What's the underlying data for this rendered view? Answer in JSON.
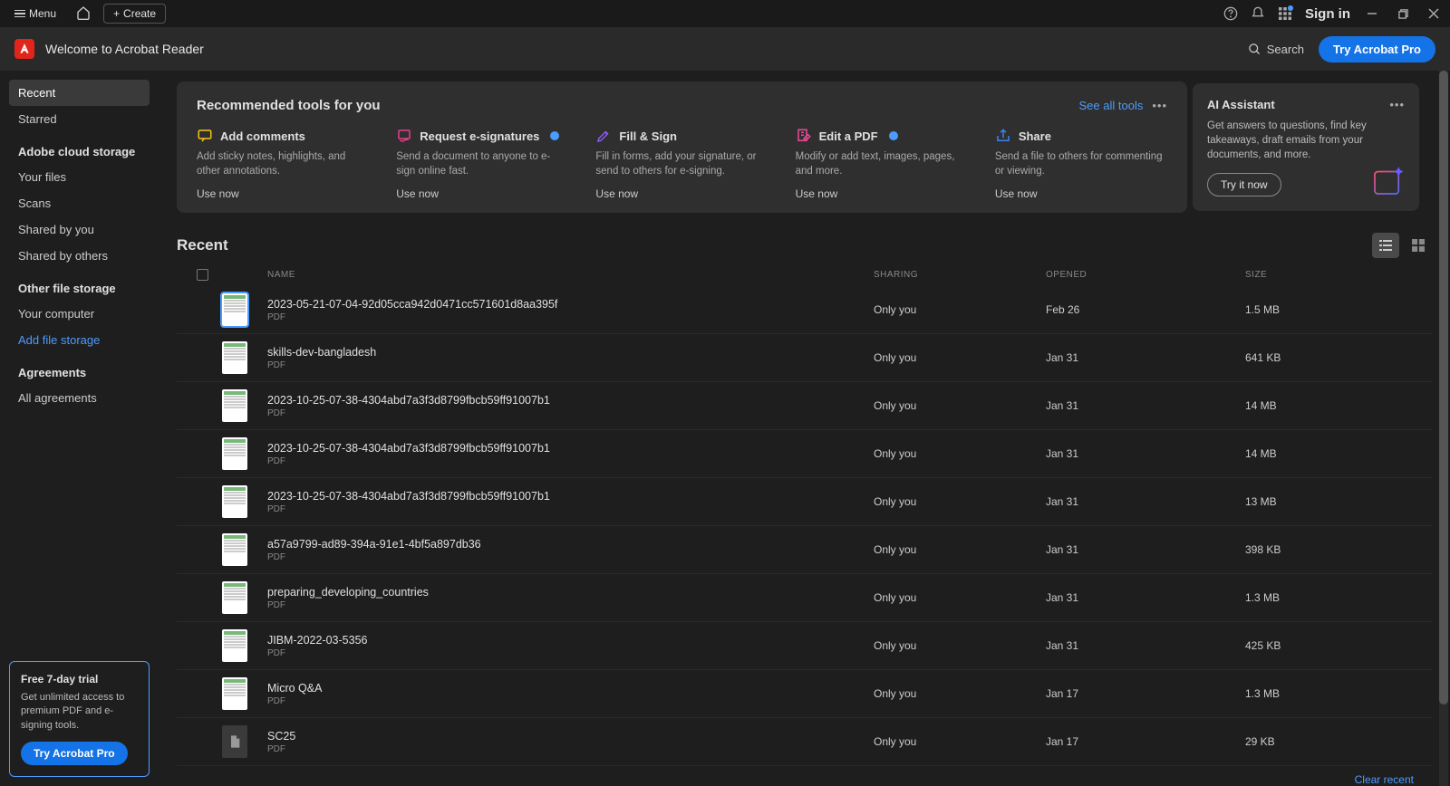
{
  "titlebar": {
    "menu": "Menu",
    "create": "Create",
    "signIn": "Sign in"
  },
  "appbar": {
    "title": "Welcome to Acrobat Reader",
    "search": "Search",
    "tryPro": "Try Acrobat Pro"
  },
  "sidebar": {
    "items": [
      "Recent",
      "Starred"
    ],
    "headers": {
      "cloud": "Adobe cloud storage",
      "other": "Other file storage",
      "agreements": "Agreements"
    },
    "cloud": [
      "Your files",
      "Scans",
      "Shared by you",
      "Shared by others"
    ],
    "other": [
      "Your computer",
      "Add file storage"
    ],
    "agreements": [
      "All agreements"
    ]
  },
  "trial": {
    "title": "Free 7-day trial",
    "desc": "Get unlimited access to premium PDF and e-signing tools.",
    "btn": "Try Acrobat Pro"
  },
  "tools": {
    "title": "Recommended tools for you",
    "seeAll": "See all tools",
    "items": [
      {
        "name": "Add comments",
        "desc": "Add sticky notes, highlights, and other annotations.",
        "icon": "comment",
        "color": "#f5c518",
        "use": "Use now"
      },
      {
        "name": "Request e-signatures",
        "desc": "Send a document to anyone to e-sign online fast.",
        "icon": "esign",
        "color": "#e83e8c",
        "use": "Use now",
        "badge": true
      },
      {
        "name": "Fill & Sign",
        "desc": "Fill in forms, add your signature, or send to others for e-signing.",
        "icon": "fillsign",
        "color": "#8b5cf6",
        "use": "Use now"
      },
      {
        "name": "Edit a PDF",
        "desc": "Modify or add text, images, pages, and more.",
        "icon": "edit",
        "color": "#ec4899",
        "use": "Use now",
        "badge": true
      },
      {
        "name": "Share",
        "desc": "Send a file to others for commenting or viewing.",
        "icon": "share",
        "color": "#3b82f6",
        "use": "Use now"
      }
    ]
  },
  "ai": {
    "title": "AI Assistant",
    "desc": "Get answers to questions, find key takeaways, draft emails from your documents, and more.",
    "btn": "Try it now"
  },
  "recent": {
    "title": "Recent",
    "columns": {
      "name": "NAME",
      "sharing": "SHARING",
      "opened": "OPENED",
      "size": "SIZE"
    },
    "clearRecent": "Clear recent",
    "files": [
      {
        "name": "2023-05-21-07-04-92d05cca942d0471cc571601d8aa395f",
        "type": "PDF",
        "sharing": "Only you",
        "opened": "Feb 26",
        "size": "1.5 MB",
        "selected": true
      },
      {
        "name": "skills-dev-bangladesh",
        "type": "PDF",
        "sharing": "Only you",
        "opened": "Jan 31",
        "size": "641 KB"
      },
      {
        "name": "2023-10-25-07-38-4304abd7a3f3d8799fbcb59ff91007b1",
        "type": "PDF",
        "sharing": "Only you",
        "opened": "Jan 31",
        "size": "14 MB"
      },
      {
        "name": "2023-10-25-07-38-4304abd7a3f3d8799fbcb59ff91007b1",
        "type": "PDF",
        "sharing": "Only you",
        "opened": "Jan 31",
        "size": "14 MB"
      },
      {
        "name": "2023-10-25-07-38-4304abd7a3f3d8799fbcb59ff91007b1",
        "type": "PDF",
        "sharing": "Only you",
        "opened": "Jan 31",
        "size": "13 MB"
      },
      {
        "name": "a57a9799-ad89-394a-91e1-4bf5a897db36",
        "type": "PDF",
        "sharing": "Only you",
        "opened": "Jan 31",
        "size": "398 KB"
      },
      {
        "name": "preparing_developing_countries",
        "type": "PDF",
        "sharing": "Only you",
        "opened": "Jan 31",
        "size": "1.3 MB"
      },
      {
        "name": "JIBM-2022-03-5356",
        "type": "PDF",
        "sharing": "Only you",
        "opened": "Jan 31",
        "size": "425 KB"
      },
      {
        "name": "Micro Q&A",
        "type": "PDF",
        "sharing": "Only you",
        "opened": "Jan 17",
        "size": "1.3 MB"
      },
      {
        "name": "SC25",
        "type": "PDF",
        "sharing": "Only you",
        "opened": "Jan 17",
        "size": "29 KB",
        "iconOnly": true
      }
    ]
  }
}
